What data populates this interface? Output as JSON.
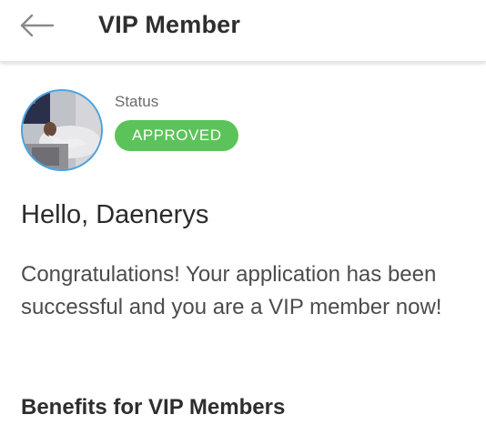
{
  "header": {
    "title": "VIP Member",
    "back_icon": "arrow-left-icon"
  },
  "profile": {
    "status_label": "Status",
    "status_value": "APPROVED",
    "status_color": "#5cc35a"
  },
  "content": {
    "greeting": "Hello, Daenerys",
    "message": "Congratulations! Your application has been successful and you are a VIP member now!",
    "benefits_heading": "Benefits for VIP Members"
  }
}
